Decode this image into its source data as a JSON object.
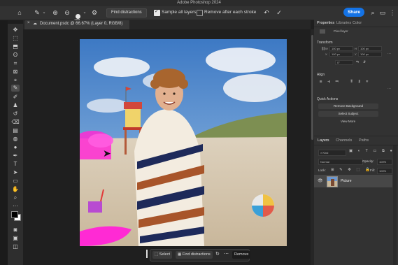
{
  "app": {
    "title": "Adobe Photoshop 2024"
  },
  "options_bar": {
    "brush_size": "100",
    "find_distractions": "Find distractions",
    "sample_all_layers": "Sample all layers",
    "remove_after_stroke": "Remove after each stroke",
    "share": "Share"
  },
  "document": {
    "tab_title": "Document.psdc @ 66.67% (Layer 0, RGB/8)"
  },
  "properties": {
    "tabs": [
      "Properties",
      "Libraries",
      "Color"
    ],
    "pixel_layer": "Pixel layer",
    "transform": "Transform",
    "w": "W",
    "h": "H",
    "x": "X",
    "y": "Y",
    "w_val": "100 px",
    "h_val": "100 px",
    "x_val": "100 px",
    "y_val": "100 px",
    "angle_val": "0°",
    "align": "Align",
    "quick_actions": "Quick Actions",
    "remove_background": "Remove Background",
    "select_subject": "Select Subject",
    "view_more": "View More"
  },
  "layers": {
    "tabs": [
      "Layers",
      "Channels",
      "Paths"
    ],
    "kind": "Kind",
    "blend_mode": "Normal",
    "opacity_label": "Opacity:",
    "opacity_value": "100%",
    "lock_label": "Lock:",
    "fill_label": "Fill:",
    "fill_value": "100%",
    "layer_name": "Picture"
  },
  "contextual_bar": {
    "select": "Select",
    "find_distractions": "Find distractions",
    "remove": "Remove"
  },
  "colors": {
    "accent": "#1473e6",
    "mask": "#ff2ad4"
  }
}
